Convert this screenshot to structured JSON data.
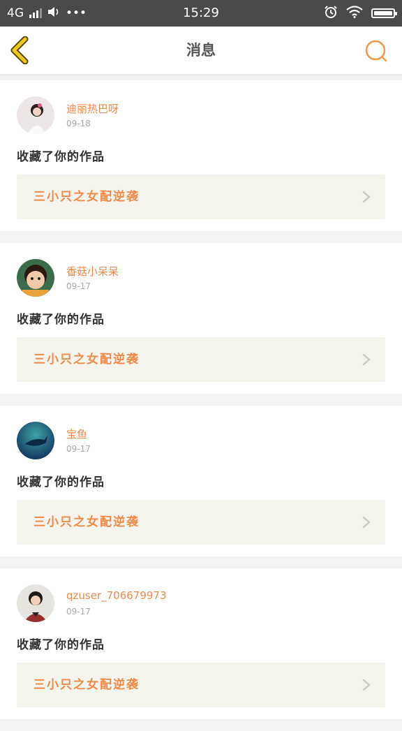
{
  "status_bar": {
    "network": "4G",
    "time": "15:29",
    "more": "•••"
  },
  "nav": {
    "title": "消息"
  },
  "messages": [
    {
      "user": "迪丽热巴呀",
      "date": "09-18",
      "action": "收藏了你的作品",
      "work": "三小只之女配逆袭",
      "avatar_color": "#e8dede"
    },
    {
      "user": "香菇小呆呆",
      "date": "09-17",
      "action": "收藏了你的作品",
      "work": "三小只之女配逆袭",
      "avatar_color": "#3a6b4a"
    },
    {
      "user": "宝鱼",
      "date": "09-17",
      "action": "收藏了你的作品",
      "work": "三小只之女配逆袭",
      "avatar_color": "#1f5f86"
    },
    {
      "user": "qzuser_706679973",
      "date": "09-17",
      "action": "收藏了你的作品",
      "work": "三小只之女配逆袭",
      "avatar_color": "#9a2e2e"
    }
  ],
  "colors": {
    "accent": "#f08a4b",
    "back_icon": "#f2c81e",
    "status_bar": "#4a4a4a",
    "card_bg": "#f4f3ec"
  }
}
